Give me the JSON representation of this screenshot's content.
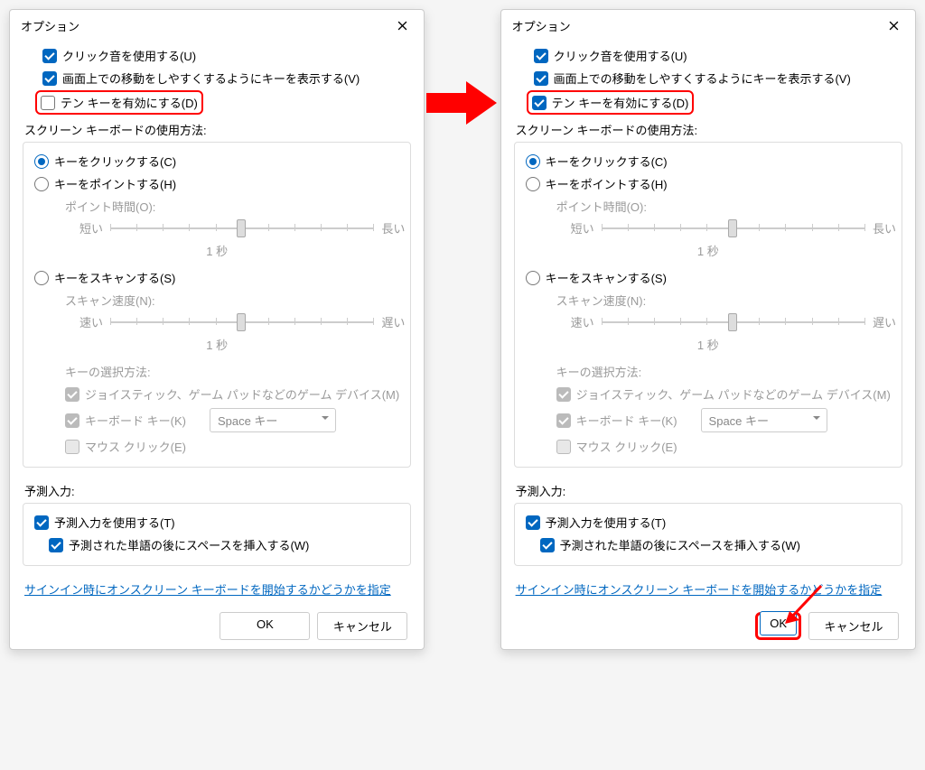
{
  "title": "オプション",
  "checkboxes": {
    "click_sound": "クリック音を使用する(U)",
    "show_move_keys": "画面上での移動をしやすくするようにキーを表示する(V)",
    "enable_tenkey": "テン キーを有効にする(D)"
  },
  "usage_section": "スクリーン キーボードの使用方法:",
  "radios": {
    "click": "キーをクリックする(C)",
    "point": "キーをポイントする(H)",
    "scan": "キーをスキャンする(S)"
  },
  "point": {
    "label": "ポイント時間(O):",
    "min": "短い",
    "max": "長い",
    "value": "1 秒"
  },
  "scan": {
    "speed_label": "スキャン速度(N):",
    "min": "速い",
    "max": "遅い",
    "value": "1 秒",
    "select_label": "キーの選択方法:",
    "joystick": "ジョイスティック、ゲーム パッドなどのゲーム デバイス(M)",
    "keyboard": "キーボード キー(K)",
    "keyboard_key": "Space キー",
    "mouse": "マウス クリック(E)"
  },
  "predict": {
    "section": "予測入力:",
    "use": "予測入力を使用する(T)",
    "space": "予測された単語の後にスペースを挿入する(W)"
  },
  "link": "サインイン時にオンスクリーン キーボードを開始するかどうかを指定",
  "buttons": {
    "ok": "OK",
    "cancel": "キャンセル"
  }
}
